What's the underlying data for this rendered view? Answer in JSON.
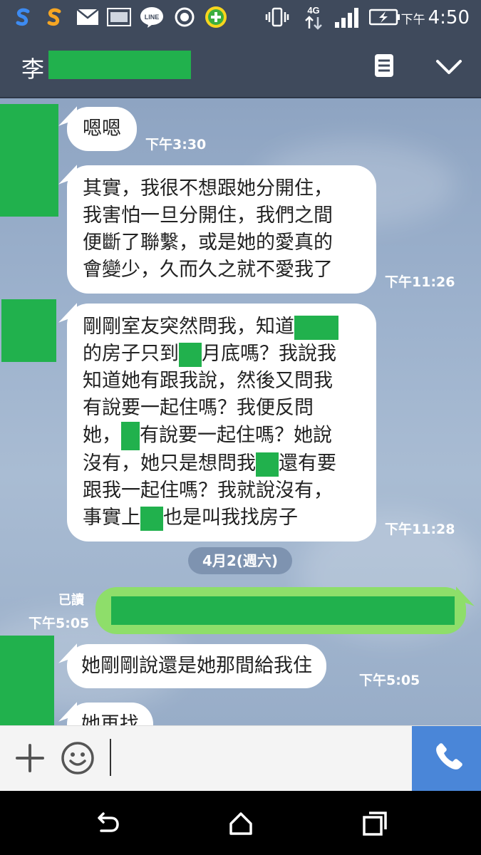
{
  "status_bar": {
    "time_ampm": "下午",
    "time": "4:50",
    "network": "4G",
    "icons": [
      "s-browser-icon-blue",
      "s-browser-icon-orange",
      "mail-icon",
      "image-icon",
      "line-icon",
      "record-icon",
      "plus-app-icon",
      "vibrate-icon",
      "network-4g-icon",
      "signal-icon",
      "battery-charging-icon"
    ]
  },
  "header": {
    "contact_name": "李",
    "icons": [
      "notes-icon",
      "chevron-down-icon"
    ]
  },
  "messages": [
    {
      "direction": "in",
      "text": "嗯嗯",
      "time": "下午3:30"
    },
    {
      "direction": "in",
      "lines": [
        "其實，我很不想跟她分開住，",
        "我害怕一旦分開住，我們之間",
        "便斷了聯繫，或是她的愛真的",
        "會變少，久而久之就不愛我了"
      ],
      "time": "下午11:26"
    },
    {
      "direction": "in",
      "segments": [
        [
          "剛剛室友突然問我，知道"
        ],
        [
          "的房子只到",
          "月底嗎？我說我"
        ],
        [
          "知道她有跟我說，然後又問我"
        ],
        [
          "有說要一起住嗎？我便反問"
        ],
        [
          "她，",
          "有說要一起住嗎？她說"
        ],
        [
          "沒有，她只是想問我",
          "還有要"
        ],
        [
          "跟我一起住嗎？我就說沒有，"
        ],
        [
          "事實上",
          "也是叫我找房子"
        ]
      ],
      "time": "下午11:28"
    },
    {
      "direction": "out",
      "read": "已讀",
      "time": "下午5:05"
    },
    {
      "direction": "in",
      "text": "她剛剛說還是她那間給我住",
      "time": "下午5:05"
    },
    {
      "direction": "in",
      "text": "她再找"
    }
  ],
  "date_separator": "4月2(週六)",
  "input_bar": {
    "icons": [
      "plus-icon",
      "emoji-icon",
      "phone-icon"
    ]
  },
  "colors": {
    "header_bg": "#3f4a5c",
    "redaction": "#21b14d",
    "outgoing_bubble": "#8ede6a",
    "call_button": "#4a86d8"
  }
}
